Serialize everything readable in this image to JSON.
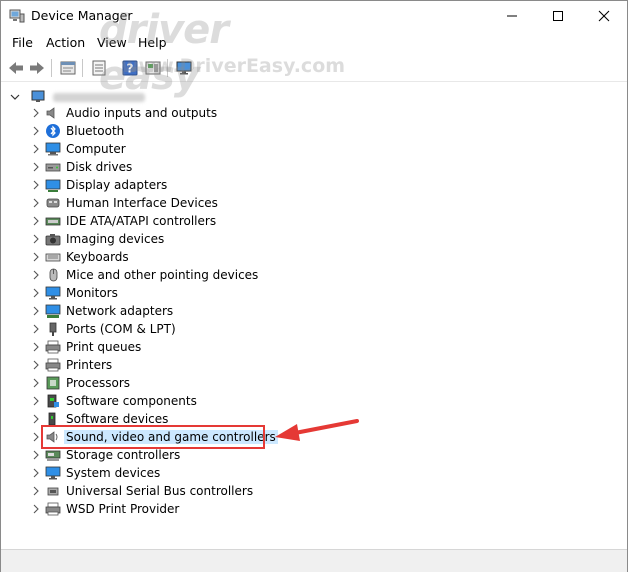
{
  "window": {
    "title": "Device Manager"
  },
  "menu": {
    "file": "File",
    "action": "Action",
    "view": "View",
    "help": "Help"
  },
  "watermark": {
    "logo": "driver easy",
    "url": "www.DriverEasy.com"
  },
  "tree": {
    "items": [
      {
        "label": "Audio inputs and outputs",
        "icon": "speaker-icon"
      },
      {
        "label": "Bluetooth",
        "icon": "bluetooth-icon"
      },
      {
        "label": "Computer",
        "icon": "computer-icon"
      },
      {
        "label": "Disk drives",
        "icon": "disk-drive-icon"
      },
      {
        "label": "Display adapters",
        "icon": "display-adapter-icon"
      },
      {
        "label": "Human Interface Devices",
        "icon": "hid-icon"
      },
      {
        "label": "IDE ATA/ATAPI controllers",
        "icon": "ide-controller-icon"
      },
      {
        "label": "Imaging devices",
        "icon": "camera-icon"
      },
      {
        "label": "Keyboards",
        "icon": "keyboard-icon"
      },
      {
        "label": "Mice and other pointing devices",
        "icon": "mouse-icon"
      },
      {
        "label": "Monitors",
        "icon": "monitor-icon"
      },
      {
        "label": "Network adapters",
        "icon": "network-adapter-icon"
      },
      {
        "label": "Ports (COM & LPT)",
        "icon": "port-icon"
      },
      {
        "label": "Print queues",
        "icon": "print-queue-icon"
      },
      {
        "label": "Printers",
        "icon": "printer-icon"
      },
      {
        "label": "Processors",
        "icon": "processor-icon"
      },
      {
        "label": "Software components",
        "icon": "software-component-icon"
      },
      {
        "label": "Software devices",
        "icon": "software-device-icon"
      },
      {
        "label": "Sound, video and game controllers",
        "icon": "sound-controller-icon"
      },
      {
        "label": "Storage controllers",
        "icon": "storage-controller-icon"
      },
      {
        "label": "System devices",
        "icon": "system-devices-icon"
      },
      {
        "label": "Universal Serial Bus controllers",
        "icon": "usb-icon"
      },
      {
        "label": "WSD Print Provider",
        "icon": "wsd-printer-icon"
      }
    ]
  },
  "colors": {
    "highlight": "#e53935",
    "selection": "#cce8ff",
    "accent": "#1e88e5"
  }
}
